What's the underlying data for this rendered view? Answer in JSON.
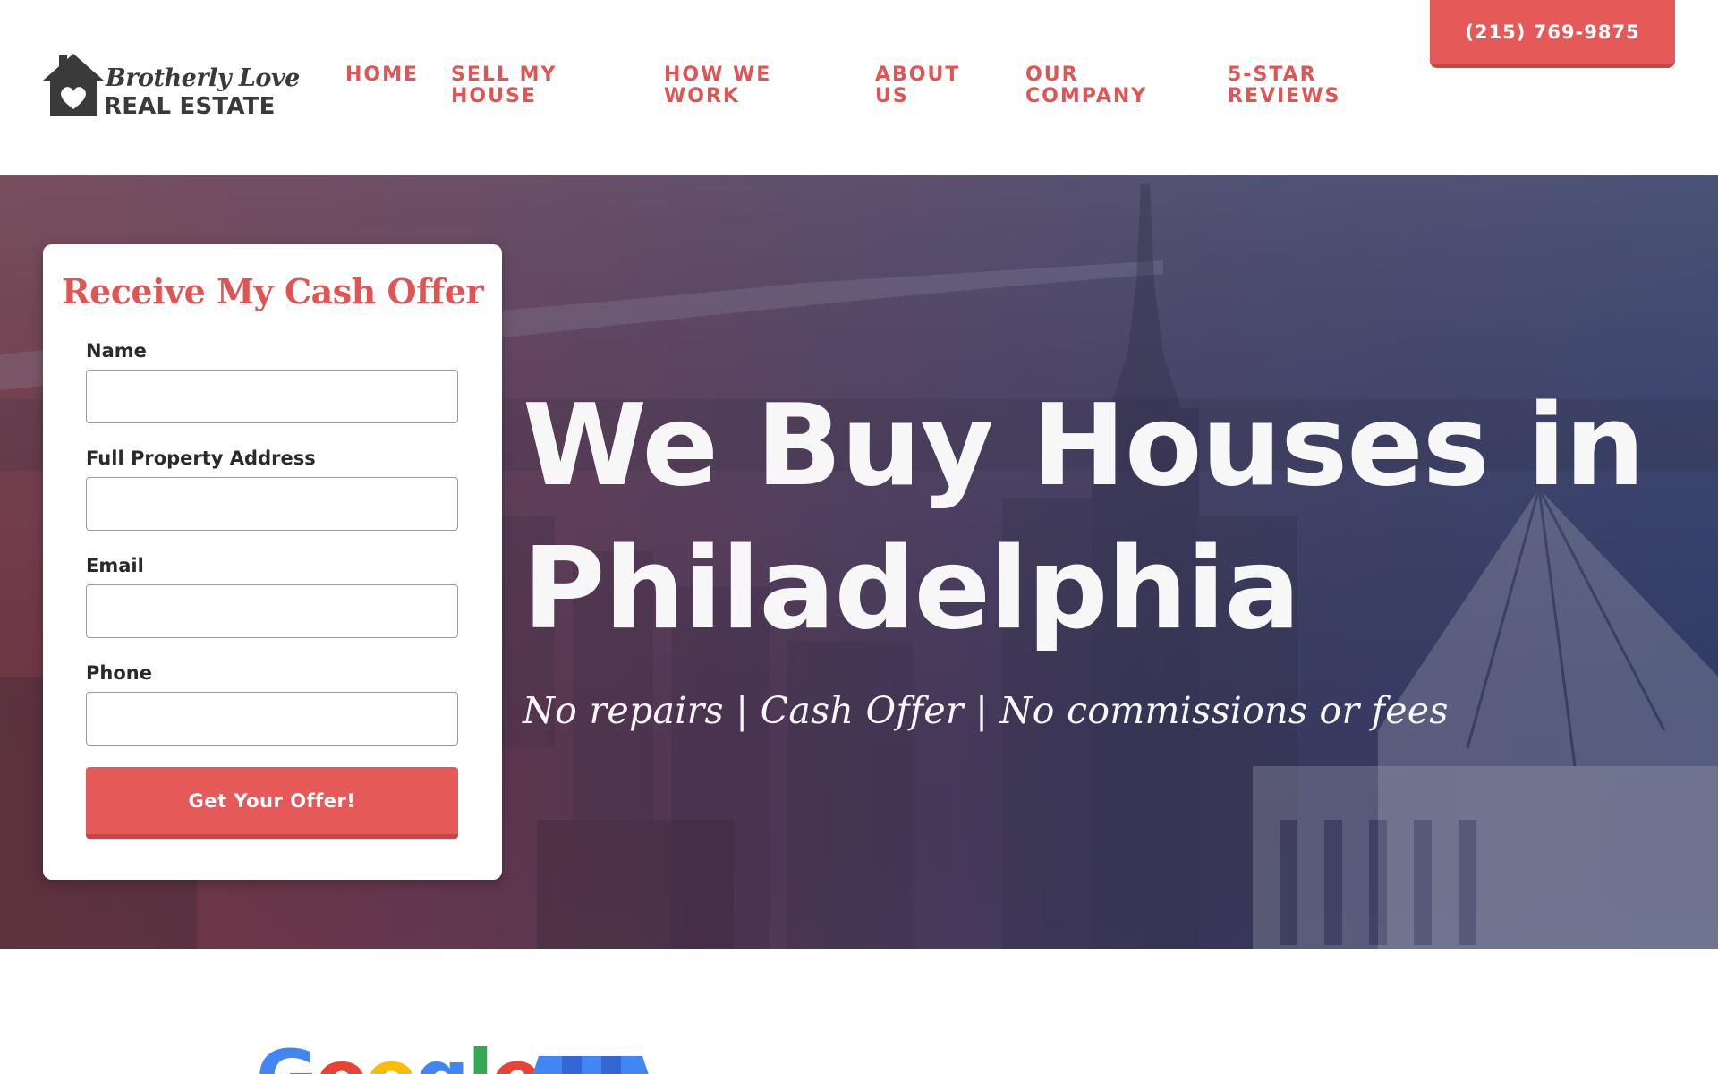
{
  "logo": {
    "script_text": "Brotherly Love",
    "caps_text": "REAL ESTATE",
    "icon": "house-heart-icon"
  },
  "nav": {
    "items": [
      {
        "label": "HOME"
      },
      {
        "label": "SELL MY HOUSE"
      },
      {
        "label": "HOW WE WORK"
      },
      {
        "label": "ABOUT US"
      },
      {
        "label": "OUR COMPANY"
      },
      {
        "label": "5-STAR REVIEWS"
      }
    ]
  },
  "phone_button": {
    "label": "(215) 769-9875"
  },
  "form": {
    "title": "Receive My Cash Offer",
    "fields": [
      {
        "label": "Name",
        "value": "",
        "placeholder": ""
      },
      {
        "label": "Full Property Address",
        "value": "",
        "placeholder": ""
      },
      {
        "label": "Email",
        "value": "",
        "placeholder": ""
      },
      {
        "label": "Phone",
        "value": "",
        "placeholder": ""
      }
    ],
    "submit_label": "Get Your Offer!"
  },
  "hero": {
    "title_line1": "We Buy Houses in",
    "title_line2": "Philadelphia",
    "subtitle": "No repairs | Cash Offer | No commissions or fees",
    "background": "philadelphia-skyline-photo"
  },
  "reviews": {
    "google_logo": {
      "letters": [
        "G",
        "o",
        "o",
        "g",
        "l",
        "e"
      ]
    },
    "gmb_icon": "google-my-business-icon"
  },
  "colors": {
    "accent": "#e55a59",
    "nav_text": "#e05554",
    "hero_left": "#7e3a44",
    "hero_right": "#2f4070",
    "white": "#ffffff"
  }
}
